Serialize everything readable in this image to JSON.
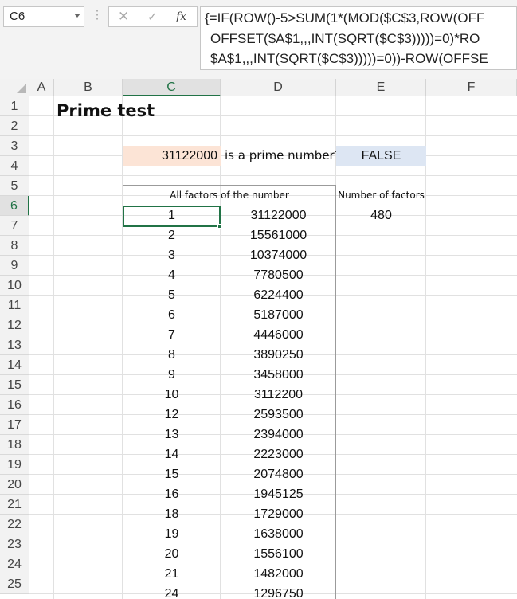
{
  "formula_bar": {
    "name_box": "C6",
    "cancel_icon": "✕",
    "enter_icon": "✓",
    "fx_label": "fx",
    "formula_lines": [
      "{=IF(ROW()-5>SUM(1*(MOD($C$3,ROW(OFF",
      "OFFSET($A$1,,,INT(SQRT($C$3)))))=0)*RO",
      "$A$1,,,INT(SQRT($C$3)))))=0))-ROW(OFFSE"
    ]
  },
  "columns": [
    "A",
    "B",
    "C",
    "D",
    "E",
    "F"
  ],
  "rows": [
    "1",
    "2",
    "3",
    "4",
    "5",
    "6",
    "7",
    "8",
    "9",
    "10",
    "11",
    "12",
    "13",
    "14",
    "15",
    "16",
    "17",
    "18",
    "19",
    "20",
    "21",
    "22",
    "23",
    "24",
    "25"
  ],
  "sheet": {
    "title": "Prime test",
    "number": "31122000",
    "question": "is a prime number?",
    "result": "FALSE",
    "factors_header": "All factors of the number",
    "count_header": "Number of factors",
    "count_value": "480",
    "factor_pairs": [
      [
        "1",
        "31122000"
      ],
      [
        "2",
        "15561000"
      ],
      [
        "3",
        "10374000"
      ],
      [
        "4",
        "7780500"
      ],
      [
        "5",
        "6224400"
      ],
      [
        "6",
        "5187000"
      ],
      [
        "7",
        "4446000"
      ],
      [
        "8",
        "3890250"
      ],
      [
        "9",
        "3458000"
      ],
      [
        "10",
        "3112200"
      ],
      [
        "12",
        "2593500"
      ],
      [
        "13",
        "2394000"
      ],
      [
        "14",
        "2223000"
      ],
      [
        "15",
        "2074800"
      ],
      [
        "16",
        "1945125"
      ],
      [
        "18",
        "1729000"
      ],
      [
        "19",
        "1638000"
      ],
      [
        "20",
        "1556100"
      ],
      [
        "21",
        "1482000"
      ],
      [
        "24",
        "1296750"
      ]
    ]
  },
  "colors": {
    "number_fill": "#fce4d6",
    "result_fill": "#dde6f3",
    "selection": "#217346"
  }
}
